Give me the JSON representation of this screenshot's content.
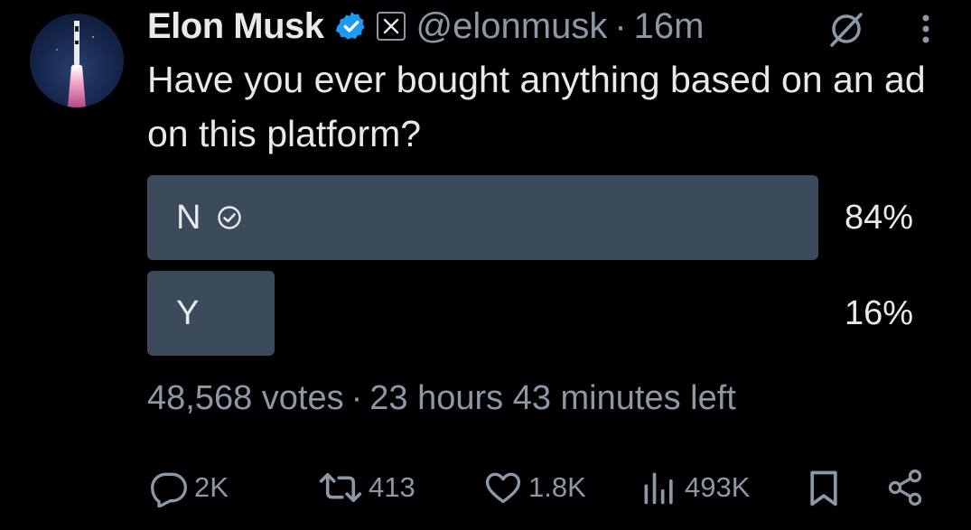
{
  "tweet": {
    "author_name": "Elon Musk",
    "handle": "@elonmusk",
    "separator": "·",
    "time": "16m",
    "text": "Have you ever bought anything based on an ad on this platform?"
  },
  "poll": {
    "options": [
      {
        "label": "N",
        "percent_text": "84%",
        "fraction": 0.84,
        "selected": true
      },
      {
        "label": "Y",
        "percent_text": "16%",
        "fraction": 0.16,
        "selected": false
      }
    ],
    "votes": "48,568 votes",
    "separator": "·",
    "time_left": "23 hours 43 minutes left"
  },
  "actions": {
    "replies": "2K",
    "reposts": "413",
    "likes": "1.8K",
    "views": "493K"
  },
  "icons": [
    "verified-badge-icon",
    "x-affiliation-icon",
    "grok-icon",
    "more-icon",
    "check-circle-icon",
    "reply-icon",
    "repost-icon",
    "like-icon",
    "views-icon",
    "bookmark-icon",
    "share-icon"
  ],
  "colors": {
    "background": "#000000",
    "text": "#e7e9ea",
    "secondary": "#8b98a5",
    "verified": "#1d9bf0",
    "poll_bar": "#3b4b5c"
  }
}
